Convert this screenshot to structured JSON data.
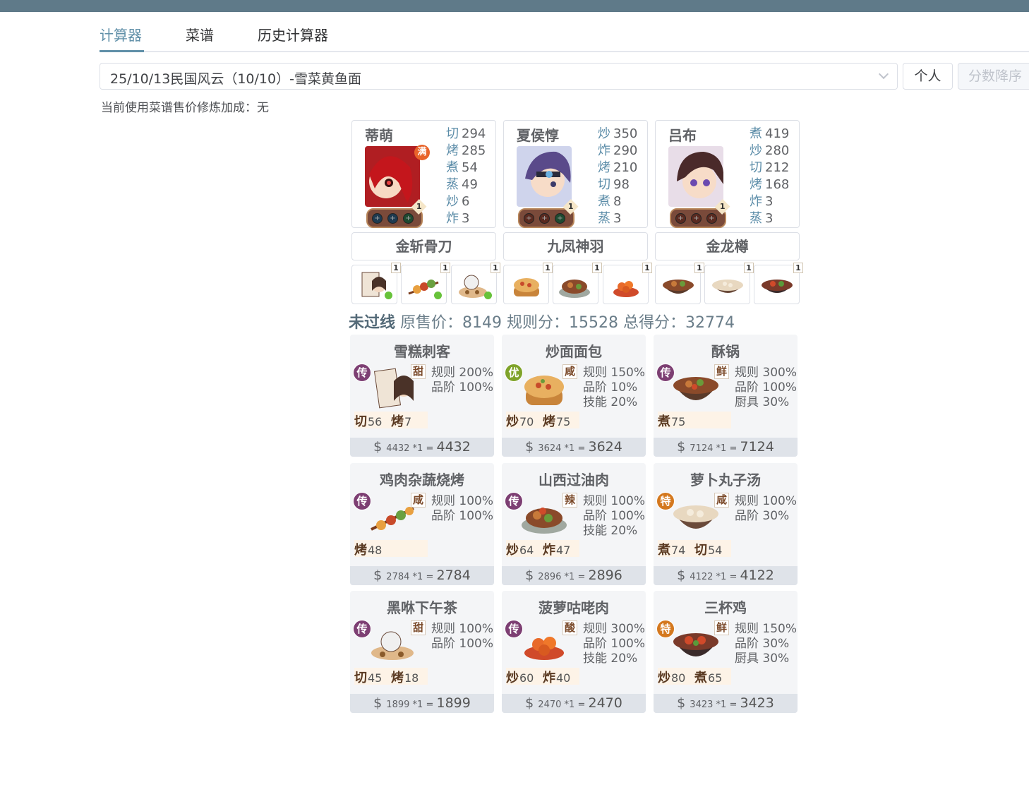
{
  "tabs": [
    {
      "label": "计算器",
      "active": true
    },
    {
      "label": "菜谱",
      "active": false
    },
    {
      "label": "历史计算器",
      "active": false
    }
  ],
  "select": {
    "value": "25/10/13民国风云（10/10）-雪菜黄鱼面"
  },
  "buttons": {
    "personal": "个人",
    "sort": "分数降序"
  },
  "bonus_note": "当前使用菜谱售价修炼加成：无",
  "chefs": [
    {
      "name": "蒂萌",
      "badge": "1",
      "full": "满",
      "stats": [
        [
          "切",
          "294"
        ],
        [
          "烤",
          "285"
        ],
        [
          "煮",
          "54"
        ],
        [
          "蒸",
          "49"
        ],
        [
          "炒",
          "6"
        ],
        [
          "炸",
          "3"
        ]
      ],
      "equip": "金斩骨刀",
      "dish_qty": [
        "1",
        "1",
        "1"
      ]
    },
    {
      "name": "夏侯惇",
      "badge": "1",
      "stats": [
        [
          "炒",
          "350"
        ],
        [
          "炸",
          "290"
        ],
        [
          "烤",
          "210"
        ],
        [
          "切",
          "98"
        ],
        [
          "煮",
          "8"
        ],
        [
          "蒸",
          "3"
        ]
      ],
      "equip": "九凤神羽",
      "dish_qty": [
        "1",
        "1",
        "1"
      ]
    },
    {
      "name": "吕布",
      "badge": "1",
      "stats": [
        [
          "煮",
          "419"
        ],
        [
          "炒",
          "280"
        ],
        [
          "切",
          "212"
        ],
        [
          "烤",
          "168"
        ],
        [
          "炸",
          "3"
        ],
        [
          "蒸",
          "3"
        ]
      ],
      "equip": "金龙樽",
      "dish_qty": [
        "1",
        "1",
        "1"
      ]
    }
  ],
  "summary": {
    "status": "未过线",
    "text": "原售价：8149 规则分：15528 总得分：32774"
  },
  "recipes": [
    {
      "name": "雪糕刺客",
      "rarity": "传",
      "taste": "甜",
      "bonus": [
        "规则 200%",
        "品阶 100%"
      ],
      "skills": [
        [
          "切",
          "56"
        ],
        [
          "烤",
          "7"
        ]
      ],
      "price": "4432",
      "mult": "*1",
      "total": "4432"
    },
    {
      "name": "炒面面包",
      "rarity": "优",
      "taste": "咸",
      "bonus": [
        "规则 150%",
        "品阶 10%",
        "技能 20%"
      ],
      "skills": [
        [
          "炒",
          "70"
        ],
        [
          "烤",
          "75"
        ]
      ],
      "price": "3624",
      "mult": "*1",
      "total": "3624"
    },
    {
      "name": "酥锅",
      "rarity": "传",
      "taste": "鲜",
      "bonus": [
        "规则 300%",
        "品阶 100%",
        "厨具 30%"
      ],
      "skills": [
        [
          "煮",
          "75"
        ]
      ],
      "price": "7124",
      "mult": "*1",
      "total": "7124"
    },
    {
      "name": "鸡肉杂蔬烧烤",
      "rarity": "传",
      "taste": "咸",
      "bonus": [
        "规则 100%",
        "品阶 100%"
      ],
      "skills": [
        [
          "烤",
          "48"
        ]
      ],
      "price": "2784",
      "mult": "*1",
      "total": "2784"
    },
    {
      "name": "山西过油肉",
      "rarity": "传",
      "taste": "辣",
      "bonus": [
        "规则 100%",
        "品阶 100%",
        "技能 20%"
      ],
      "skills": [
        [
          "炒",
          "64"
        ],
        [
          "炸",
          "47"
        ]
      ],
      "price": "2896",
      "mult": "*1",
      "total": "2896"
    },
    {
      "name": "萝卜丸子汤",
      "rarity": "特",
      "taste": "咸",
      "bonus": [
        "规则 100%",
        "品阶 30%"
      ],
      "skills": [
        [
          "煮",
          "74"
        ],
        [
          "切",
          "54"
        ]
      ],
      "price": "4122",
      "mult": "*1",
      "total": "4122"
    },
    {
      "name": "黑咻下午茶",
      "rarity": "传",
      "taste": "甜",
      "bonus": [
        "规则 100%",
        "品阶 100%"
      ],
      "skills": [
        [
          "切",
          "45"
        ],
        [
          "烤",
          "18"
        ]
      ],
      "price": "1899",
      "mult": "*1",
      "total": "1899"
    },
    {
      "name": "菠萝咕咾肉",
      "rarity": "传",
      "taste": "酸",
      "bonus": [
        "规则 300%",
        "品阶 100%",
        "技能 20%"
      ],
      "skills": [
        [
          "炒",
          "60"
        ],
        [
          "炸",
          "40"
        ]
      ],
      "price": "2470",
      "mult": "*1",
      "total": "2470"
    },
    {
      "name": "三杯鸡",
      "rarity": "特",
      "taste": "鲜",
      "bonus": [
        "规则 150%",
        "品阶 30%",
        "厨具 30%"
      ],
      "skills": [
        [
          "炒",
          "80"
        ],
        [
          "煮",
          "65"
        ]
      ],
      "price": "3423",
      "mult": "*1",
      "total": "3423"
    }
  ],
  "colors": {
    "legend": "#7d3f73",
    "good": "#7fa32a",
    "special": "#d4781e",
    "accent": "#5f8fa8"
  }
}
